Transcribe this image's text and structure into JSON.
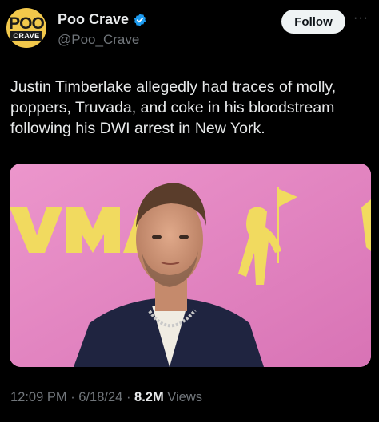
{
  "author": {
    "avatar_line1": "POO",
    "avatar_line2": "CRAVE",
    "name": "Poo Crave",
    "handle": "@Poo_Crave",
    "verified_color": "#1d9bf0"
  },
  "actions": {
    "follow_label": "Follow",
    "more_icon": "more-icon"
  },
  "tweet": {
    "text": "Justin Timberlake allegedly had traces of molly, poppers, Truvada, and coke in his bloodstream following his DWI arrest in New York."
  },
  "media": {
    "backdrop_color": "#e58ac4",
    "logo_color": "#f2df5a"
  },
  "meta": {
    "time": "12:09 PM",
    "sep1": " · ",
    "date": "6/18/24",
    "sep2": " · ",
    "views_count": "8.2M",
    "views_label": " Views"
  }
}
